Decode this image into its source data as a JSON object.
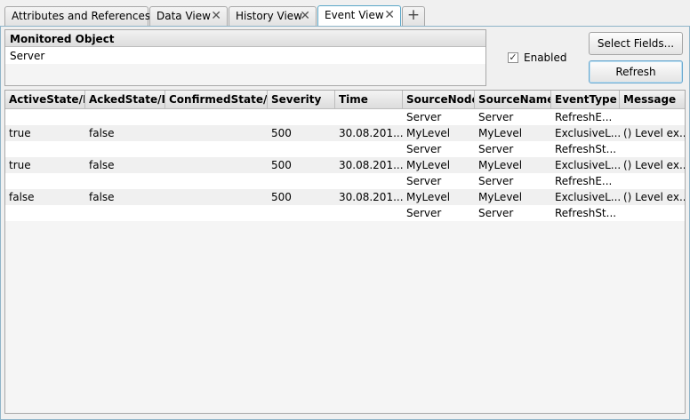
{
  "tabs": [
    {
      "label": "Attributes and References",
      "closable": false,
      "active": false
    },
    {
      "label": "Data View",
      "closable": true,
      "active": false
    },
    {
      "label": "History View",
      "closable": true,
      "active": false
    },
    {
      "label": "Event View",
      "closable": true,
      "active": true
    }
  ],
  "add_tab_icon": "+",
  "close_icon": "✕",
  "monitor": {
    "header": "Monitored Object",
    "value": "Server"
  },
  "enabled": {
    "label": "Enabled",
    "checked": true
  },
  "buttons": {
    "select_fields": "Select Fields...",
    "refresh": "Refresh"
  },
  "columns": [
    "ActiveState/Id",
    "AckedState/Id",
    "ConfirmedState/Id",
    "Severity",
    "Time",
    "SourceNode",
    "SourceName",
    "EventType",
    "Message"
  ],
  "rows": [
    [
      "",
      "",
      "",
      "",
      "",
      "Server",
      "Server",
      "RefreshE...",
      ""
    ],
    [
      "true",
      "false",
      "",
      "500",
      "30.08.201...",
      "MyLevel",
      "MyLevel",
      "ExclusiveL...",
      "() Level ex..."
    ],
    [
      "",
      "",
      "",
      "",
      "",
      "Server",
      "Server",
      "RefreshSt...",
      ""
    ],
    [
      "true",
      "false",
      "",
      "500",
      "30.08.201...",
      "MyLevel",
      "MyLevel",
      "ExclusiveL...",
      "() Level ex..."
    ],
    [
      "",
      "",
      "",
      "",
      "",
      "Server",
      "Server",
      "RefreshE...",
      ""
    ],
    [
      "false",
      "false",
      "",
      "500",
      "30.08.201...",
      "MyLevel",
      "MyLevel",
      "ExclusiveL...",
      "() Level ex..."
    ],
    [
      "",
      "",
      "",
      "",
      "",
      "Server",
      "Server",
      "RefreshSt...",
      ""
    ]
  ]
}
